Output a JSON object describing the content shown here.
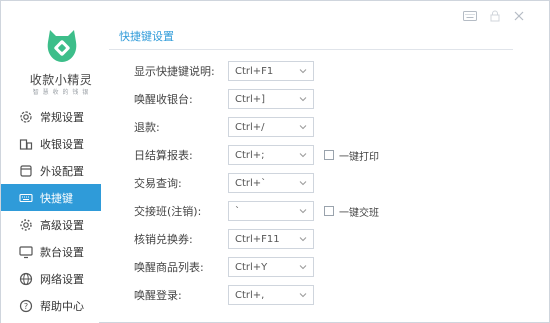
{
  "app": {
    "name": "收款小精灵",
    "slogan": "智 慧 收 的 钱 银"
  },
  "colors": {
    "accent": "#2f9bd9",
    "logo": "#3dbe8a"
  },
  "sidebar": {
    "items": [
      {
        "label": "常规设置",
        "icon": "gear-icon",
        "active": false
      },
      {
        "label": "收银设置",
        "icon": "cashier-icon",
        "active": false
      },
      {
        "label": "外设配置",
        "icon": "device-icon",
        "active": false
      },
      {
        "label": "快捷键",
        "icon": "keyboard-icon",
        "active": true
      },
      {
        "label": "高级设置",
        "icon": "advanced-gear-icon",
        "active": false
      },
      {
        "label": "款台设置",
        "icon": "monitor-icon",
        "active": false
      },
      {
        "label": "网络设置",
        "icon": "globe-icon",
        "active": false
      },
      {
        "label": "帮助中心",
        "icon": "help-icon",
        "active": false
      }
    ]
  },
  "panel": {
    "title": "快捷键设置"
  },
  "shortcuts": [
    {
      "label": "显示快捷键说明:",
      "value": "Ctrl+F1"
    },
    {
      "label": "唤醒收银台:",
      "value": "Ctrl+]"
    },
    {
      "label": "退款:",
      "value": "Ctrl+/"
    },
    {
      "label": "日结算报表:",
      "value": "Ctrl+;",
      "checkbox": "一键打印"
    },
    {
      "label": "交易查询:",
      "value": "Ctrl+`"
    },
    {
      "label": "交接班(注销):",
      "value": "`",
      "checkbox": "一键交班"
    },
    {
      "label": "核销兑换券:",
      "value": "Ctrl+F11"
    },
    {
      "label": "唤醒商品列表:",
      "value": "Ctrl+Y"
    },
    {
      "label": "唤醒登录:",
      "value": "Ctrl+,"
    }
  ]
}
